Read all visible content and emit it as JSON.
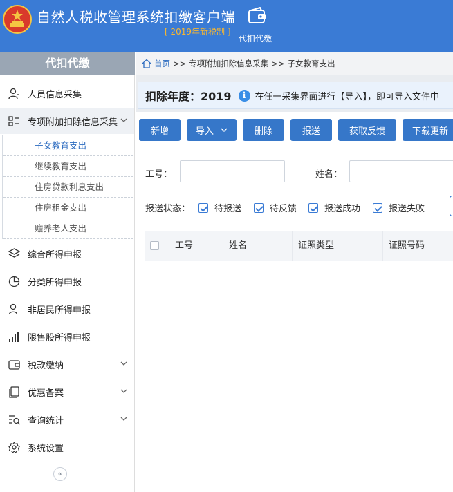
{
  "header": {
    "title": "自然人税收管理系统扣缴客户端",
    "subtitle": "[ 2019年新税制 ]",
    "module_label": "代扣代缴",
    "emblem_icon": "national-emblem-icon",
    "module_icon": "wallet-icon",
    "bg_color": "#3a7bd5"
  },
  "sidebar": {
    "title": "代扣代缴",
    "items": [
      {
        "label": "人员信息采集",
        "icon": "person-icon"
      },
      {
        "label": "专项附加扣除信息采集",
        "icon": "list-icon",
        "expanded": true
      },
      {
        "label": "综合所得申报",
        "icon": "layers-icon"
      },
      {
        "label": "分类所得申报",
        "icon": "pie-chart-icon"
      },
      {
        "label": "非居民所得申报",
        "icon": "user-icon"
      },
      {
        "label": "限售股所得申报",
        "icon": "bar-chart-icon"
      },
      {
        "label": "税款缴纳",
        "icon": "wallet-icon",
        "expandable": true
      },
      {
        "label": "优惠备案",
        "icon": "document-icon",
        "expandable": true
      },
      {
        "label": "查询统计",
        "icon": "query-icon",
        "expandable": true
      },
      {
        "label": "系统设置",
        "icon": "gear-icon"
      }
    ],
    "sub_items": [
      "子女教育支出",
      "继续教育支出",
      "住房贷款利息支出",
      "住房租金支出",
      "赡养老人支出"
    ],
    "collapse_icon": "«"
  },
  "breadcrumb": {
    "home": "首页",
    "sep": ">>",
    "level1": "专项附加扣除信息采集",
    "level2": "子女教育支出"
  },
  "notice": {
    "year_label": "扣除年度：2019",
    "info_icon": "i",
    "tip": "在任一采集界面进行【导入】，即可导入文件中"
  },
  "toolbar": {
    "add": "新增",
    "import": "导入",
    "delete": "删除",
    "submit": "报送",
    "feedback": "获取反馈",
    "download": "下载更新"
  },
  "filters": {
    "id_label": "工号：",
    "name_label": "姓名：",
    "status_label": "报送状态：",
    "statuses": [
      "待报送",
      "待反馈",
      "报送成功",
      "报送失败"
    ]
  },
  "table": {
    "columns": [
      "工号",
      "姓名",
      "证照类型",
      "证照号码"
    ]
  }
}
